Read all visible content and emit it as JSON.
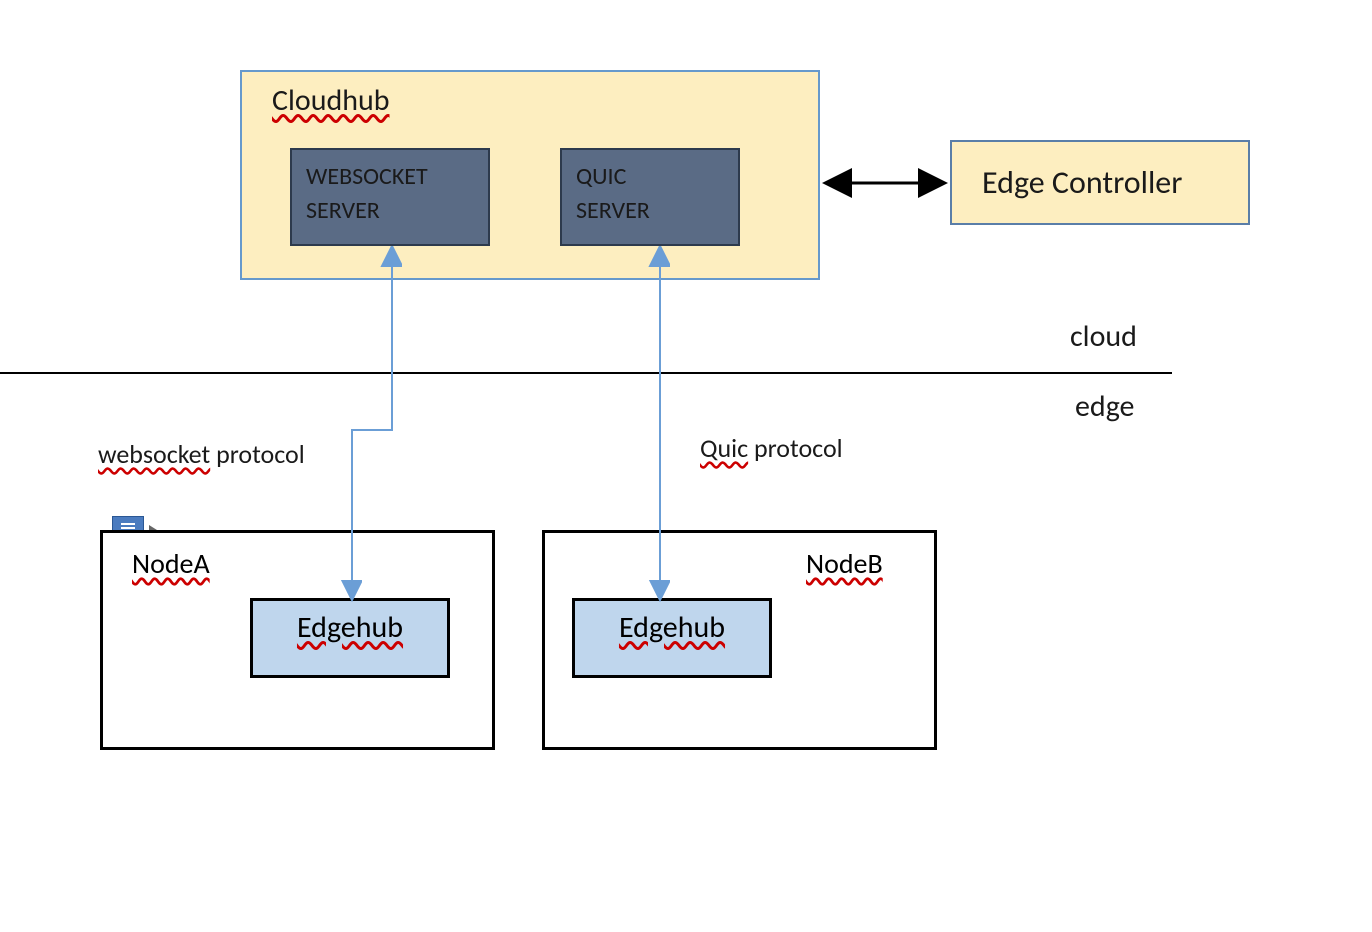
{
  "cloudhub": {
    "title": "Cloudhub",
    "servers": [
      {
        "name": "WEBSOCKET SERVER"
      },
      {
        "name": "QUIC SERVER"
      }
    ]
  },
  "edgeController": {
    "label": "Edge Controller"
  },
  "divider": {
    "topLabel": "cloud",
    "bottomLabel": "edge"
  },
  "protocols": {
    "left": {
      "label_plain": "websocket",
      "label_rest": " protocol"
    },
    "right": {
      "label_plain": "Quic",
      "label_rest": " protocol"
    }
  },
  "nodes": [
    {
      "title": "NodeA",
      "inner": "Edgehub"
    },
    {
      "title": "NodeB",
      "inner": "Edgehub"
    }
  ]
}
